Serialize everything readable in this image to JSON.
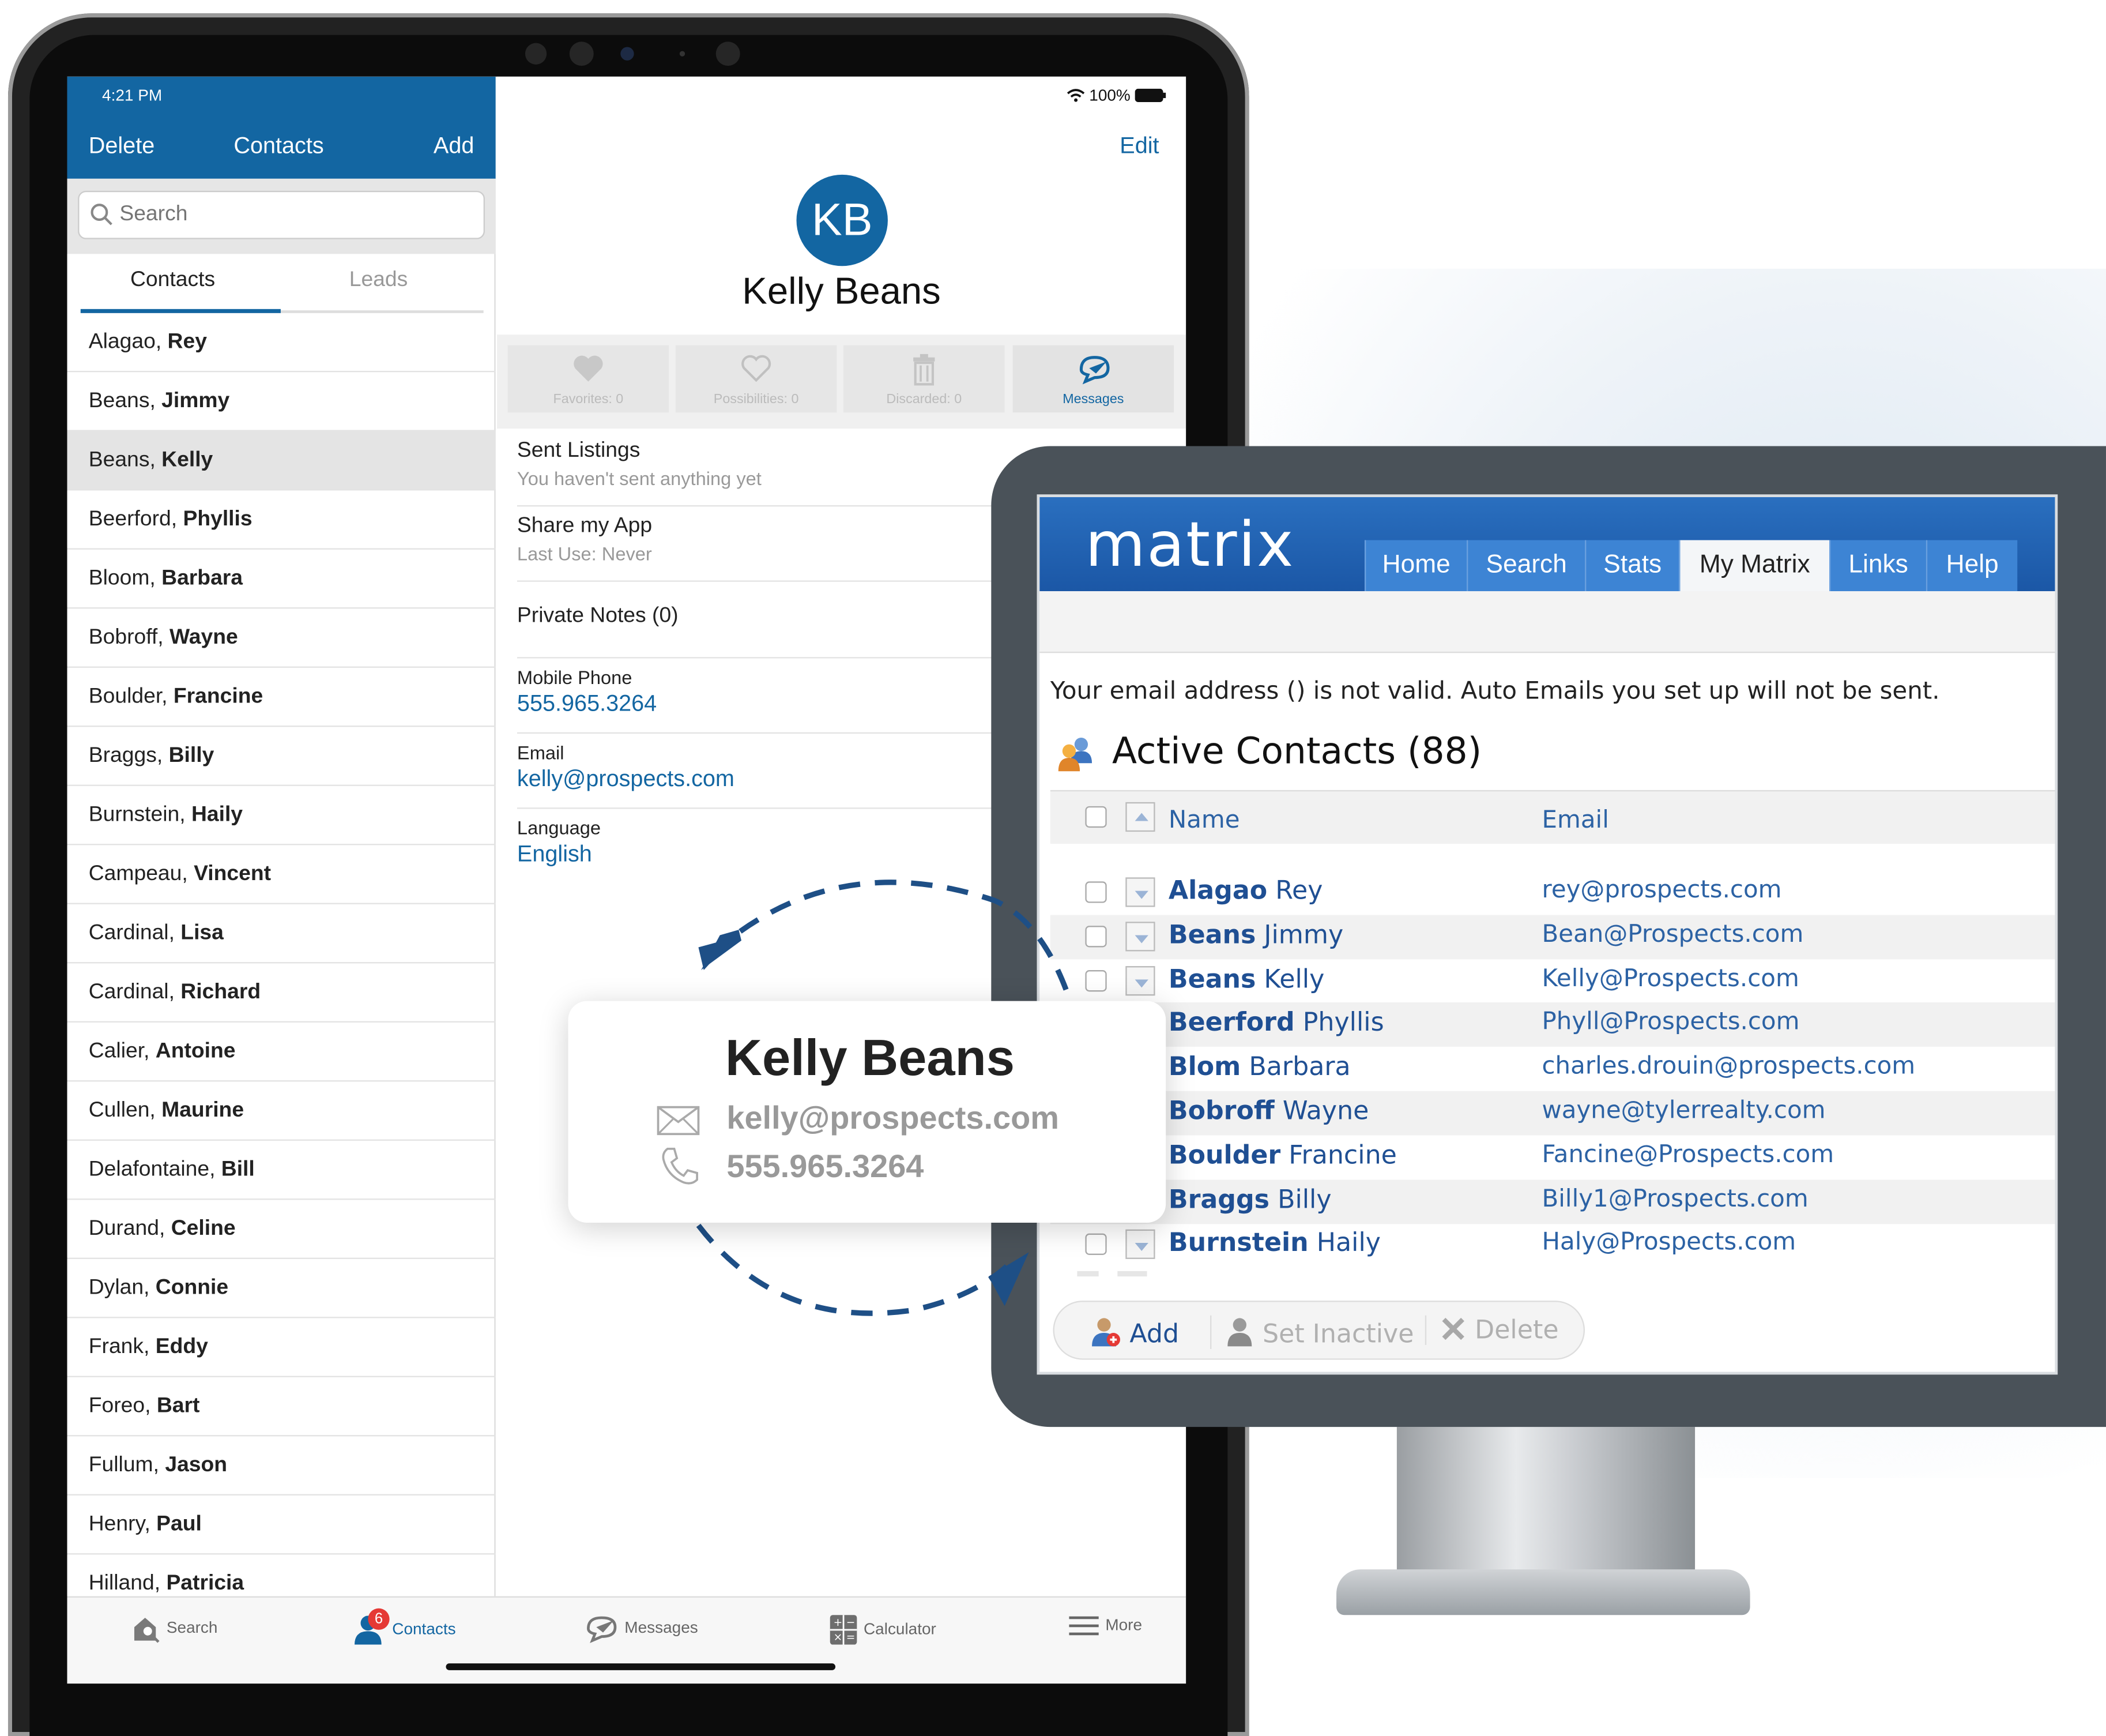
{
  "ipad": {
    "status": {
      "time": "4:21 PM",
      "battery": "100%"
    },
    "header": {
      "delete_label": "Delete",
      "title": "Contacts",
      "add_label": "Add"
    },
    "search": {
      "placeholder": "Search"
    },
    "segments": {
      "contacts": "Contacts",
      "leads": "Leads"
    },
    "contacts": [
      {
        "last": "Alagao",
        "first": "Rey"
      },
      {
        "last": "Beans",
        "first": "Jimmy"
      },
      {
        "last": "Beans",
        "first": "Kelly",
        "selected": true
      },
      {
        "last": "Beerford",
        "first": "Phyllis"
      },
      {
        "last": "Bloom",
        "first": "Barbara"
      },
      {
        "last": "Bobroff",
        "first": "Wayne"
      },
      {
        "last": "Boulder",
        "first": "Francine"
      },
      {
        "last": "Braggs",
        "first": "Billy"
      },
      {
        "last": "Burnstein",
        "first": "Haily"
      },
      {
        "last": "Campeau",
        "first": "Vincent"
      },
      {
        "last": "Cardinal",
        "first": "Lisa"
      },
      {
        "last": "Cardinal",
        "first": "Richard"
      },
      {
        "last": "Calier",
        "first": "Antoine"
      },
      {
        "last": "Cullen",
        "first": "Maurine"
      },
      {
        "last": "Delafontaine",
        "first": "Bill"
      },
      {
        "last": "Durand",
        "first": "Celine"
      },
      {
        "last": "Dylan",
        "first": "Connie"
      },
      {
        "last": "Frank",
        "first": "Eddy"
      },
      {
        "last": "Foreo",
        "first": "Bart"
      },
      {
        "last": "Fullum",
        "first": "Jason"
      },
      {
        "last": "Henry",
        "first": "Paul"
      },
      {
        "last": "Hilland",
        "first": "Patricia"
      }
    ],
    "detail": {
      "edit_label": "Edit",
      "initials": "KB",
      "name": "Kelly Beans",
      "actions": [
        {
          "label": "Favorites: 0",
          "icon": "heart-icon"
        },
        {
          "label": "Possibilities: 0",
          "icon": "heart-outline-icon"
        },
        {
          "label": "Discarded: 0",
          "icon": "trash-icon"
        },
        {
          "label": "Messages",
          "icon": "message-icon"
        }
      ],
      "sent_listings": {
        "title": "Sent Listings",
        "sub": "You haven't sent anything yet"
      },
      "share_app": {
        "title": "Share my App",
        "sub": "Last Use: Never"
      },
      "private_notes": "Private Notes (0)",
      "mobile": {
        "label": "Mobile Phone",
        "value": "555.965.3264"
      },
      "email": {
        "label": "Email",
        "value": "kelly@prospects.com"
      },
      "language": {
        "label": "Language",
        "value": "English"
      }
    },
    "tabbar": {
      "search": "Search",
      "contacts": "Contacts",
      "contacts_badge": "6",
      "messages": "Messages",
      "calculator": "Calculator",
      "more": "More"
    }
  },
  "matrix": {
    "logo": "matrix",
    "nav": [
      "Home",
      "Search",
      "Stats",
      "My Matrix",
      "Links",
      "Help"
    ],
    "active_nav": "My Matrix",
    "warning": "Your email address () is not valid. Auto Emails you set up will not be sent.",
    "title": "Active Contacts (88)",
    "columns": {
      "name": "Name",
      "email": "Email"
    },
    "rows": [
      {
        "last": "Alagao",
        "first": "Rey",
        "email": "rey@prospects.com"
      },
      {
        "last": "Beans",
        "first": "Jimmy",
        "email": "Bean@Prospects.com"
      },
      {
        "last": "Beans",
        "first": "Kelly",
        "email": "Kelly@Prospects.com"
      },
      {
        "last": "Beerford",
        "first": "Phyllis",
        "email": "Phyll@Prospects.com"
      },
      {
        "last": "Blom",
        "first": "Barbara",
        "email": "charles.drouin@prospects.com"
      },
      {
        "last": "Bobroff",
        "first": "Wayne",
        "email": "wayne@tylerrealty.com"
      },
      {
        "last": "Boulder",
        "first": "Francine",
        "email": "Fancine@Prospects.com"
      },
      {
        "last": "Braggs",
        "first": "Billy",
        "email": "Billy1@Prospects.com"
      },
      {
        "last": "Burnstein",
        "first": "Haily",
        "email": "Haly@Prospects.com"
      }
    ],
    "buttons": {
      "add": "Add",
      "set_inactive": "Set Inactive",
      "delete": "Delete"
    }
  },
  "callout": {
    "name": "Kelly Beans",
    "email": "kelly@prospects.com",
    "phone": "555.965.3264"
  },
  "colors": {
    "brand": "#1366a2",
    "matrix_header": "#1b57a6",
    "link": "#2c62a4"
  }
}
